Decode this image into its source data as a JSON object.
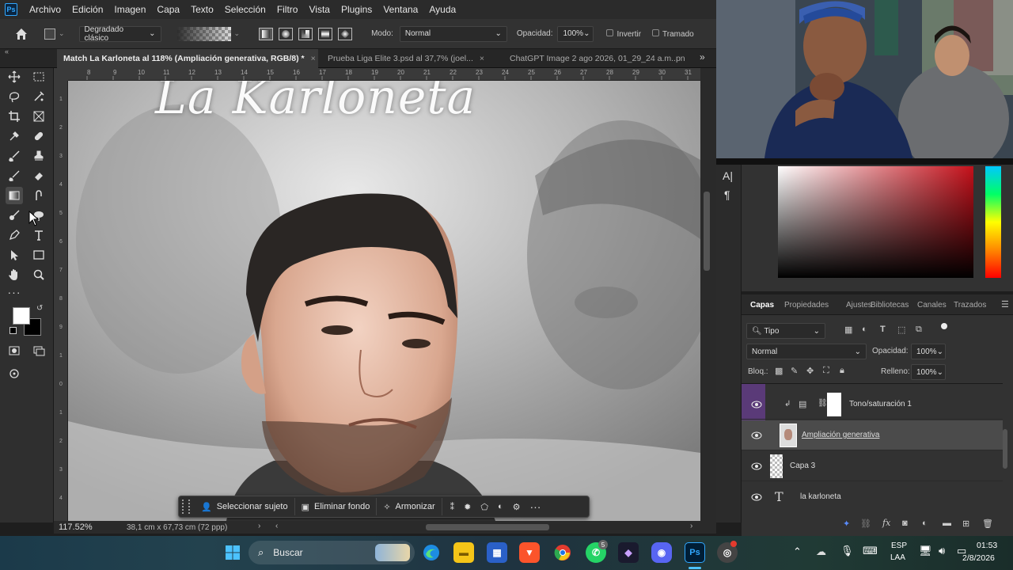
{
  "menubar": {
    "logo": "Ps",
    "items": [
      "Archivo",
      "Edición",
      "Imagen",
      "Capa",
      "Texto",
      "Selección",
      "Filtro",
      "Vista",
      "Plugins",
      "Ventana",
      "Ayuda"
    ]
  },
  "options": {
    "gradient_preset": "Degradado clásico",
    "mode_label": "Modo:",
    "mode_value": "Normal",
    "opacity_label": "Opacidad:",
    "opacity_value": "100%",
    "invert_label": "Invertir",
    "dither_label": "Tramado"
  },
  "tabs": [
    {
      "label": "Match La Karloneta al 118% (Ampliación generativa, RGB/8) *",
      "active": true
    },
    {
      "label": "Prueba Liga Elite 3.psd al 37,7% (joel...",
      "active": false
    },
    {
      "label": "ChatGPT Image 2 ago 2026, 01_29_24 a.m..pn",
      "active": false
    }
  ],
  "ruler": {
    "h_ticks": [
      "8",
      "9",
      "10",
      "11",
      "12",
      "13",
      "14",
      "15",
      "16",
      "17",
      "18",
      "19",
      "20",
      "21",
      "22",
      "23",
      "24",
      "25",
      "26",
      "27",
      "28",
      "29",
      "30",
      "31",
      "32"
    ],
    "v_ticks": [
      "1",
      "2",
      "3",
      "4",
      "5",
      "6",
      "7",
      "8",
      "9",
      "1",
      "0",
      "1",
      "2",
      "3",
      "4"
    ]
  },
  "canvas": {
    "title_text": "La Karloneta"
  },
  "context_bar": {
    "select_subject": "Seleccionar sujeto",
    "remove_bg": "Eliminar fondo",
    "harmonize": "Armonizar"
  },
  "status": {
    "zoom": "117.52%",
    "doc_size": "38,1 cm x 67,73 cm (72 ppp)"
  },
  "char_panel": {
    "char_icon": "A|",
    "para_icon": "¶"
  },
  "colors": {
    "accent": "#31a8ff",
    "layer_selected": "#4b4b4b",
    "visibility_highlight": "#5a3a78"
  },
  "layers_panel": {
    "tabs": [
      "Capas",
      "Propiedades",
      "Ajustes",
      "Bibliotecas",
      "Canales",
      "Trazados"
    ],
    "filter_label": "Tipo",
    "blend_mode": "Normal",
    "opacity_label": "Opacidad:",
    "opacity_value": "100%",
    "lock_label": "Bloq.:",
    "fill_label": "Relleno:",
    "fill_value": "100%",
    "layers": [
      {
        "name": "Tono/saturación 1",
        "type": "adjustment",
        "visible": true
      },
      {
        "name": "Ampliación generativa",
        "type": "generative",
        "visible": true,
        "selected": true
      },
      {
        "name": "Capa 3",
        "type": "pixel",
        "visible": true
      },
      {
        "name": "la karloneta",
        "type": "text",
        "visible": true
      }
    ]
  },
  "taskbar": {
    "search_placeholder": "Buscar",
    "lang": "ESP",
    "region": "LAA",
    "time": "01:53",
    "date": "2/8/2026",
    "whatsapp_badge": "5"
  }
}
